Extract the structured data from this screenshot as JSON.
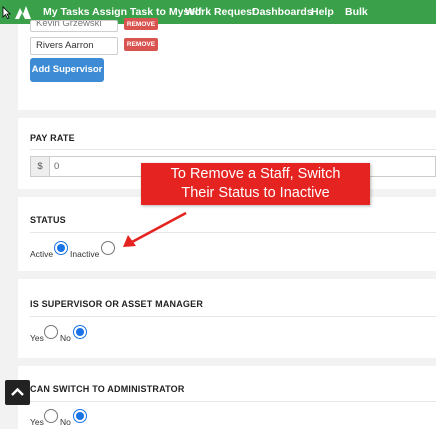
{
  "nav": {
    "items": [
      "My Tasks",
      "Assign Task to Myself",
      "Work Request",
      "Dashboards",
      "Help",
      "Bulk"
    ]
  },
  "supervisors": {
    "rows": [
      {
        "name": "Kevin Grzewski",
        "remove_label": "REMOVE"
      },
      {
        "name": "Rivers Aarron",
        "remove_label": "REMOVE"
      }
    ],
    "add_label": "Add Supervisor"
  },
  "pay_rate": {
    "title": "PAY RATE",
    "currency": "$",
    "value": "0"
  },
  "callout": {
    "line1": "To Remove a Staff, Switch",
    "line2": "Their Status to Inactive"
  },
  "status": {
    "title": "STATUS",
    "active_label": "Active",
    "inactive_label": "Inactive",
    "selected": "Active"
  },
  "supervisor_or_asset": {
    "title": "IS SUPERVISOR OR ASSET MANAGER",
    "yes_label": "Yes",
    "no_label": "No",
    "selected": "No"
  },
  "switch_admin": {
    "title": "CAN SWITCH TO ADMINISTRATOR",
    "yes_label": "Yes",
    "no_label": "No",
    "selected": "No"
  },
  "colors": {
    "nav": "#3aa04a",
    "primary_button": "#3d8bd4",
    "remove_button": "#d9534f",
    "callout": "#e52320",
    "radio_checked": "#1a73e8"
  }
}
